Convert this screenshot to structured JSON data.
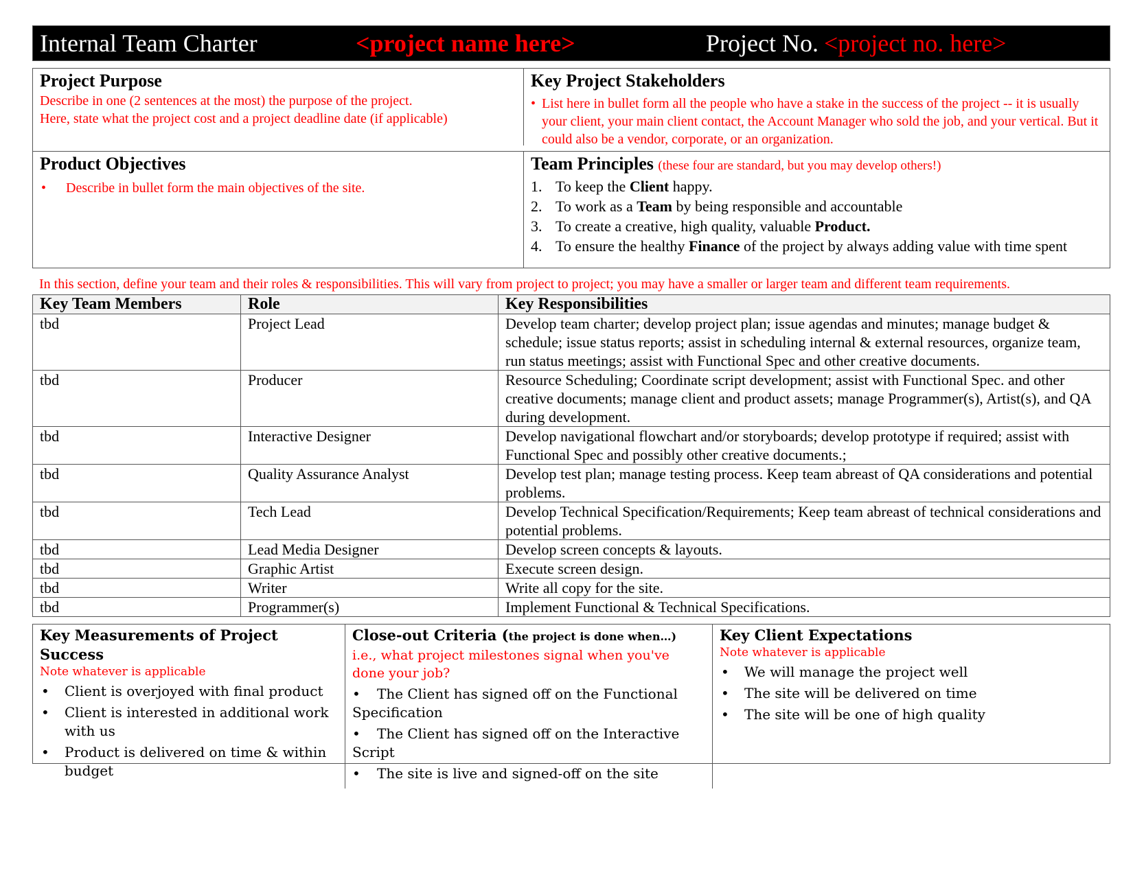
{
  "header": {
    "title": "Internal Team Charter",
    "project_name": "<project name here>",
    "project_no_label": "Project No.",
    "project_no": "<project no. here>"
  },
  "purpose": {
    "heading": "Project Purpose",
    "lines": [
      "Describe in one (2 sentences at the most) the purpose of the project.",
      "Here, state what the project cost and a project deadline date (if applicable)"
    ]
  },
  "stakeholders": {
    "heading": "Key Project Stakeholders",
    "items": [
      "List here in bullet form all the people who have a stake in the success of the project -- it is usually your client, your main client contact, the Account Manager who sold the job, and your vertical. But it could also be a vendor, corporate, or an organization."
    ]
  },
  "objectives": {
    "heading": "Product Objectives",
    "items": [
      "Describe in bullet form the main objectives of the site."
    ]
  },
  "principles": {
    "heading": "Team Principles",
    "note": "(these four are standard, but you may develop others!)",
    "items": [
      {
        "num": "1.",
        "before": "To keep the ",
        "bold": "Client",
        "after": " happy."
      },
      {
        "num": "2.",
        "before": "To work as a ",
        "bold": "Team",
        "after": " by being responsible and accountable"
      },
      {
        "num": "3.",
        "before": "To create a creative, high quality, valuable ",
        "bold": "Product.",
        "after": ""
      },
      {
        "num": "4.",
        "before": "To ensure the healthy ",
        "bold": "Finance",
        "after": " of the project by always adding value with time spent"
      }
    ]
  },
  "team_note": "In this section, define your team and their roles & responsibilities. This will vary from project to project; you may have a smaller or larger team and different team requirements.",
  "team_table": {
    "headers": [
      "Key Team Members",
      "Role",
      "Key Responsibilities"
    ],
    "rows": [
      {
        "member": "tbd",
        "role": "Project Lead",
        "resp": "Develop team charter; develop project plan; issue agendas and minutes; manage budget & schedule; issue status reports; assist in scheduling internal & external resources, organize team, run status meetings; assist with Functional Spec and other creative documents."
      },
      {
        "member": "tbd",
        "role": "Producer",
        "resp": "Resource Scheduling; Coordinate script development; assist with Functional Spec. and other creative documents; manage client and product assets; manage Programmer(s), Artist(s), and QA during development."
      },
      {
        "member": "tbd",
        "role": "Interactive Designer",
        "resp": "Develop navigational flowchart and/or storyboards; develop prototype if required; assist with Functional Spec and possibly other creative documents.;"
      },
      {
        "member": "tbd",
        "role": "Quality Assurance Analyst",
        "resp": "Develop test plan; manage testing process. Keep team abreast of QA considerations and potential problems."
      },
      {
        "member": "tbd",
        "role": "Tech Lead",
        "resp": "Develop Technical Specification/Requirements; Keep team abreast of technical considerations and potential problems."
      },
      {
        "member": "tbd",
        "role": "Lead Media Designer",
        "resp": "Develop screen concepts & layouts."
      },
      {
        "member": "tbd",
        "role": "Graphic Artist",
        "resp": "Execute screen design."
      },
      {
        "member": "tbd",
        "role": "Writer",
        "resp": "Write all copy for the site."
      },
      {
        "member": "tbd",
        "role": "Programmer(s)",
        "resp": "Implement Functional & Technical Specifications."
      }
    ]
  },
  "measurements": {
    "heading": "Key Measurements of Project Success",
    "note": "Note whatever is applicable",
    "items": [
      "Client is overjoyed with final product",
      "Client is interested in additional work with us",
      "Product is delivered on time & within budget"
    ]
  },
  "closeout": {
    "heading": "Close-out Criteria (",
    "heading_small": "the project is done when…)",
    "note": "i.e., what project milestones signal when you've done your job?",
    "items": [
      "The Client has signed off on the Functional Specification",
      "The Client has signed off on the Interactive Script",
      "The site is live and signed-off on the site"
    ]
  },
  "expectations": {
    "heading": "Key Client Expectations",
    "note": "Note whatever is applicable",
    "items": [
      "We will manage the project well",
      "The site will be delivered on time",
      "The site will be one of high quality"
    ]
  }
}
